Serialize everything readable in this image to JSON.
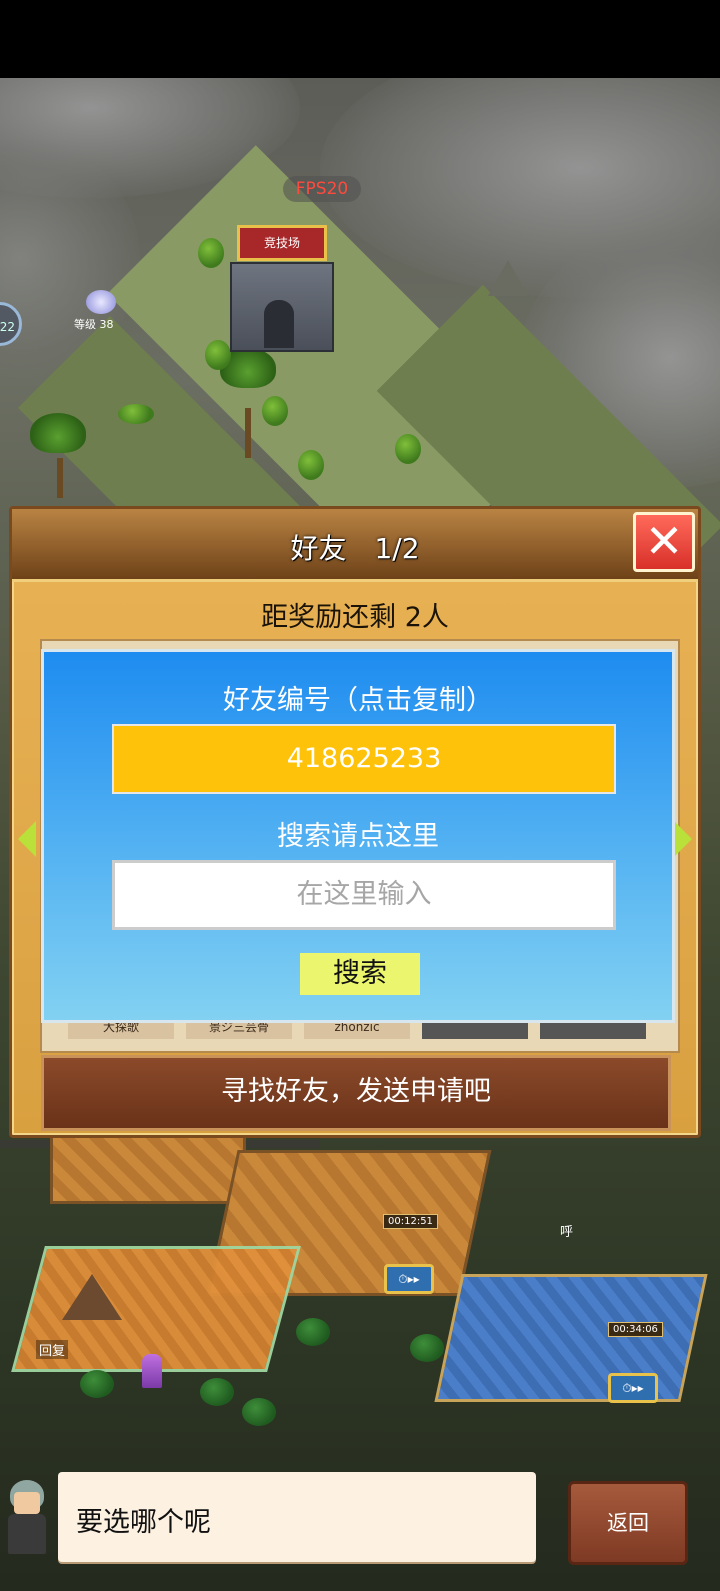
{
  "game": {
    "fps": "FPS20",
    "arena_label": "竞技场",
    "level_label": "等级 38",
    "side_counter": "22",
    "timer_1": "00:12:51",
    "timer_2": "00:34:06",
    "recover_label": "回复",
    "shout": "呼",
    "fast_forward": "⏱▸▸"
  },
  "dialog": {
    "title": "好友　1/2",
    "close_icon": "close-x",
    "remaining": "距奖励还剩 2人",
    "list_names": [
      "大探歌",
      "景ジ三芸骨",
      "zhonzic"
    ],
    "friend_code_label": "好友编号（点击复制）",
    "friend_code": "418625233",
    "search_hint": "搜索请点这里",
    "search_placeholder": "在这里输入",
    "search_button": "搜索",
    "find_friends_button": "寻找好友，发送申请吧"
  },
  "footer": {
    "prompt": "要选哪个呢",
    "back_button": "返回"
  },
  "colors": {
    "panel_top": "#1e8cf0",
    "friend_code_bg": "#ffc20a",
    "search_button_bg": "#ecf56e",
    "close_button": "#d8302a",
    "dialog_frame": "#e9b356"
  }
}
